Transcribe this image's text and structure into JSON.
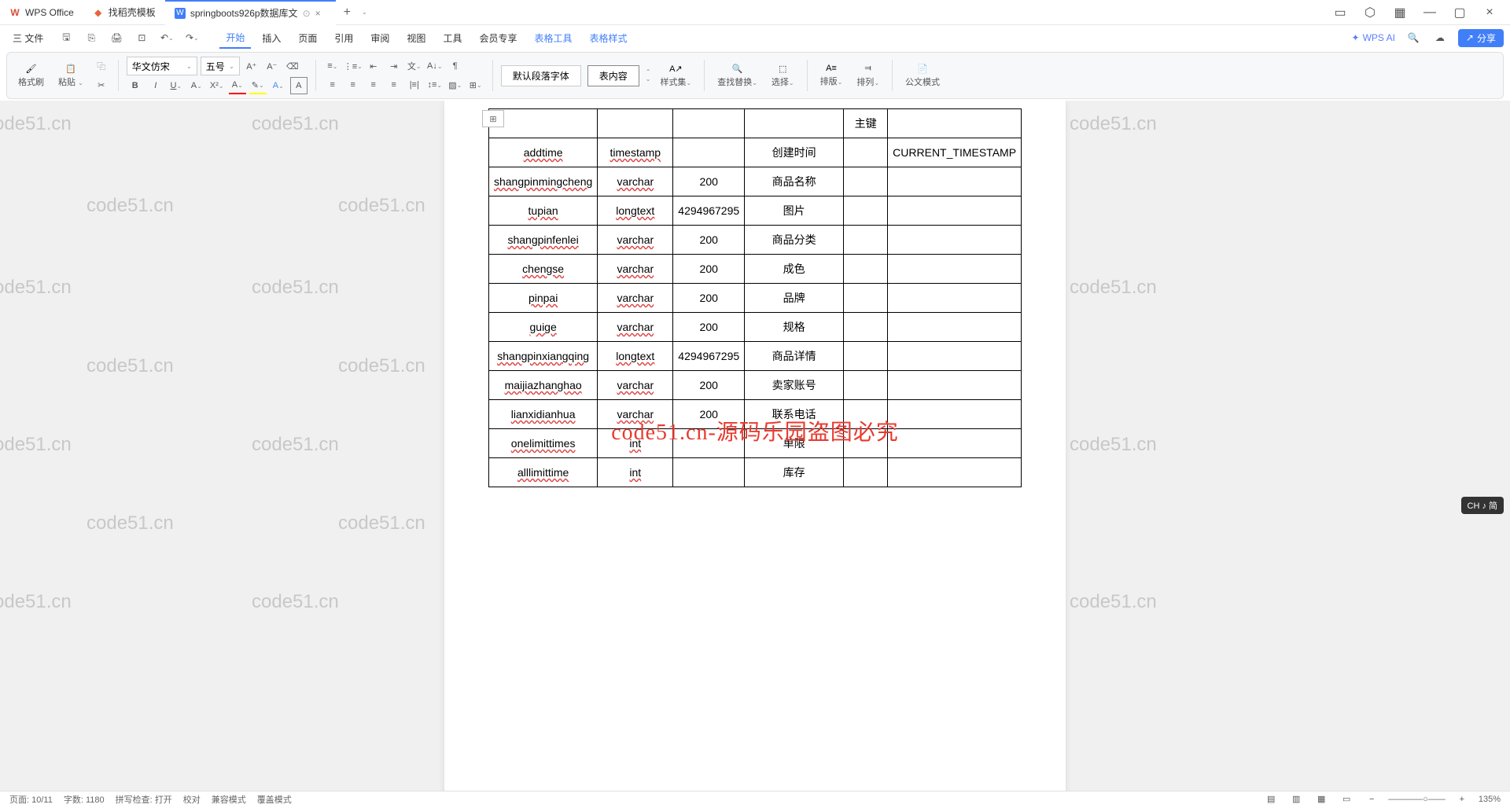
{
  "tabs": {
    "items": [
      {
        "icon": "wps",
        "label": "WPS Office",
        "color": "#d94b3a"
      },
      {
        "icon": "template",
        "label": "找稻壳模板",
        "color": "#e8653a"
      },
      {
        "icon": "word",
        "label": "springboots926p数据库文",
        "color": "#417ff9",
        "active": true,
        "closable": true,
        "badge": "⊙"
      }
    ],
    "add": "+"
  },
  "menu": {
    "file": "三 文件",
    "tabs": [
      "开始",
      "插入",
      "页面",
      "引用",
      "审阅",
      "视图",
      "工具",
      "会员专享",
      "表格工具",
      "表格样式"
    ],
    "active": 0,
    "wps_ai": "WPS AI",
    "share": "分享"
  },
  "toolbar": {
    "brush": "格式刷",
    "paste": "粘贴",
    "font_name": "华文仿宋",
    "font_size": "五号",
    "style_default": "默认段落字体",
    "style_body": "表内容",
    "style_set": "样式集",
    "find_replace": "查找替换",
    "select": "选择",
    "arrange_v": "排版",
    "arrange_h": "排列",
    "gov_mode": "公文模式"
  },
  "table": {
    "header_pk": "主键",
    "rows": [
      {
        "c1": "addtime",
        "c2": "timestamp",
        "c3": "",
        "c4": "创建时间",
        "c5": "",
        "c6": "CURRENT_TIMESTAMP"
      },
      {
        "c1": "shangpinmingcheng",
        "c2": "varchar",
        "c3": "200",
        "c4": "商品名称",
        "c5": "",
        "c6": ""
      },
      {
        "c1": "tupian",
        "c2": "longtext",
        "c3": "4294967295",
        "c4": "图片",
        "c5": "",
        "c6": ""
      },
      {
        "c1": "shangpinfenlei",
        "c2": "varchar",
        "c3": "200",
        "c4": "商品分类",
        "c5": "",
        "c6": ""
      },
      {
        "c1": "chengse",
        "c2": "varchar",
        "c3": "200",
        "c4": "成色",
        "c5": "",
        "c6": ""
      },
      {
        "c1": "pinpai",
        "c2": "varchar",
        "c3": "200",
        "c4": "品牌",
        "c5": "",
        "c6": ""
      },
      {
        "c1": "guige",
        "c2": "varchar",
        "c3": "200",
        "c4": "规格",
        "c5": "",
        "c6": ""
      },
      {
        "c1": "shangpinxiangqing",
        "c2": "longtext",
        "c3": "4294967295",
        "c4": "商品详情",
        "c5": "",
        "c6": ""
      },
      {
        "c1": "maijiazhanghao",
        "c2": "varchar",
        "c3": "200",
        "c4": "卖家账号",
        "c5": "",
        "c6": ""
      },
      {
        "c1": "lianxidianhua",
        "c2": "varchar",
        "c3": "200",
        "c4": "联系电话",
        "c5": "",
        "c6": ""
      },
      {
        "c1": "onelimittimes",
        "c2": "int",
        "c3": "",
        "c4": "单限",
        "c5": "",
        "c6": ""
      },
      {
        "c1": "alllimittime",
        "c2": "int",
        "c3": "",
        "c4": "库存",
        "c5": "",
        "c6": ""
      }
    ]
  },
  "watermark": {
    "text": "code51.cn",
    "overlay": "code51.cn-源码乐园盗图必究"
  },
  "status": {
    "page": "页面: 10/11",
    "words": "字数: 1180",
    "spell": "拼写检查: 打开",
    "proof": "校对",
    "compat": "兼容模式",
    "insert": "覆盖模式",
    "zoom": "135%"
  },
  "ime": "CH ♪ 简",
  "page_nav": "⊞"
}
